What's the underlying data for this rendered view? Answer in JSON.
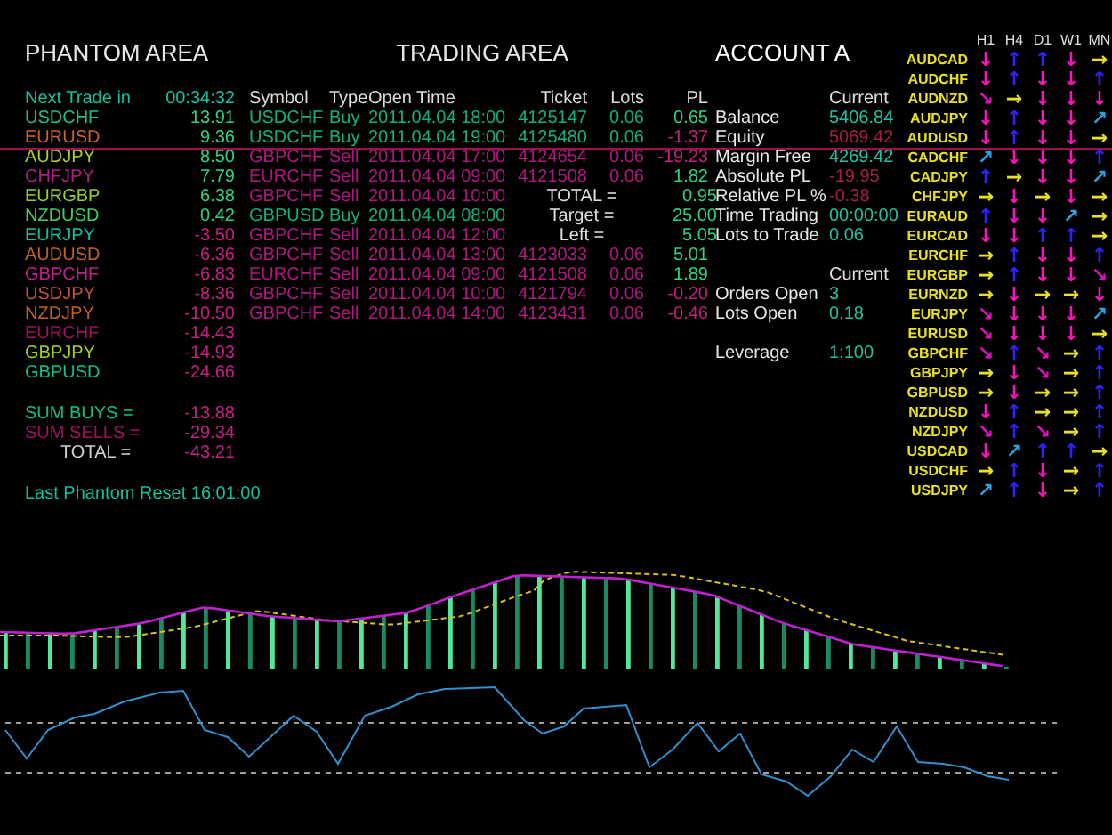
{
  "phantom": {
    "title": "PHANTOM AREA",
    "next_trade_label": "Next Trade in",
    "next_trade_time": "00:34:32",
    "pairs": [
      {
        "symbol": "USDCHF",
        "value": "13.91",
        "color": "#20c080",
        "negative": false
      },
      {
        "symbol": "EURUSD",
        "value": "9.36",
        "color": "#d06030",
        "negative": false
      },
      {
        "symbol": "AUDJPY",
        "value": "8.50",
        "color": "#a8d020",
        "negative": false
      },
      {
        "symbol": "CHFJPY",
        "value": "7.79",
        "color": "#b02080",
        "negative": false
      },
      {
        "symbol": "EURGBP",
        "value": "6.38",
        "color": "#90d030",
        "negative": false
      },
      {
        "symbol": "NZDUSD",
        "value": "0.42",
        "color": "#40d060",
        "negative": false
      },
      {
        "symbol": "EURJPY",
        "value": "-3.50",
        "color": "#10c0a0",
        "negative": true
      },
      {
        "symbol": "AUDUSD",
        "value": "-6.36",
        "color": "#c06030",
        "negative": true
      },
      {
        "symbol": "GBPCHF",
        "value": "-6.83",
        "color": "#c02090",
        "negative": true
      },
      {
        "symbol": "USDJPY",
        "value": "-8.36",
        "color": "#c05040",
        "negative": true
      },
      {
        "symbol": "NZDJPY",
        "value": "-10.50",
        "color": "#c06020",
        "negative": true
      },
      {
        "symbol": "EURCHF",
        "value": "-14.43",
        "color": "#a01060",
        "negative": true
      },
      {
        "symbol": "GBPJPY",
        "value": "-14.93",
        "color": "#a0d020",
        "negative": true
      },
      {
        "symbol": "GBPUSD",
        "value": "-24.66",
        "color": "#10c090",
        "negative": true
      }
    ],
    "sums": [
      {
        "label": "SUM BUYS =",
        "value": "-13.88",
        "color": "#10c080"
      },
      {
        "label": "SUM SELLS =",
        "value": "-29.34",
        "color": "#a01060"
      },
      {
        "label": "TOTAL =",
        "value": "-43.21",
        "color": "#d0d0d0"
      }
    ],
    "reset": "Last Phantom Reset 16:01:00"
  },
  "trading": {
    "title": "TRADING AREA",
    "columns": [
      "Symbol",
      "Type",
      "Open Time",
      "Ticket",
      "Lots",
      "PL"
    ],
    "trades": [
      {
        "kind": "trade",
        "symbol": "USDCHF",
        "type": "Buy",
        "open_time": "2011.04.04 18:00",
        "ticket": "4125147",
        "lots": "0.06",
        "pl": "0.65",
        "color": "#10b080",
        "pl_negative": false
      },
      {
        "kind": "trade",
        "symbol": "USDCHF",
        "type": "Buy",
        "open_time": "2011.04.04 19:00",
        "ticket": "4125480",
        "lots": "0.06",
        "pl": "-1.37",
        "color": "#10b080",
        "pl_negative": true
      },
      {
        "kind": "trade",
        "symbol": "GBPCHF",
        "type": "Sell",
        "open_time": "2011.04.04 17:00",
        "ticket": "4124654",
        "lots": "0.06",
        "pl": "-19.23",
        "color": "#b01880",
        "pl_negative": true
      },
      {
        "kind": "trade",
        "symbol": "EURCHF",
        "type": "Sell",
        "open_time": "2011.04.04 09:00",
        "ticket": "4121508",
        "lots": "0.06",
        "pl": "1.82",
        "color": "#b01880",
        "pl_negative": false
      },
      {
        "kind": "partial",
        "symbol": "GBPCHF",
        "type": "Sell",
        "open_time": "2011.04.04 10:00",
        "color": "#b01880"
      },
      {
        "kind": "partial",
        "symbol": "GBPUSD",
        "type": "Buy",
        "open_time": "2011.04.04 08:00",
        "color": "#10b080"
      },
      {
        "kind": "partial",
        "symbol": "GBPCHF",
        "type": "Sell",
        "open_time": "2011.04.04 12:00",
        "color": "#b01880"
      },
      {
        "kind": "trade",
        "symbol": "GBPCHF",
        "type": "Sell",
        "open_time": "2011.04.04 13:00",
        "ticket": "4123033",
        "lots": "0.06",
        "pl": "5.01",
        "color": "#b01880",
        "pl_negative": false
      },
      {
        "kind": "trade",
        "symbol": "EURCHF",
        "type": "Sell",
        "open_time": "2011.04.04 09:00",
        "ticket": "4121508",
        "lots": "0.06",
        "pl": "1.89",
        "color": "#b01880",
        "pl_negative": false
      },
      {
        "kind": "trade",
        "symbol": "GBPCHF",
        "type": "Sell",
        "open_time": "2011.04.04 10:00",
        "ticket": "4121794",
        "lots": "0.06",
        "pl": "-0.20",
        "color": "#b01880",
        "pl_negative": true
      },
      {
        "kind": "trade",
        "symbol": "GBPCHF",
        "type": "Sell",
        "open_time": "2011.04.04 14:00",
        "ticket": "4123431",
        "lots": "0.06",
        "pl": "-0.46",
        "color": "#b01880",
        "pl_negative": true
      }
    ],
    "summary": [
      {
        "label": "TOTAL =",
        "value": "0.95"
      },
      {
        "label": "Target =",
        "value": "25.00"
      },
      {
        "label": "Left =",
        "value": "5.05"
      }
    ]
  },
  "account": {
    "title": "ACCOUNT A",
    "sections": [
      {
        "header": "Current",
        "rows": [
          {
            "label": "Balance",
            "value": "5406.84",
            "color": "#20c0a0"
          },
          {
            "label": "Equity",
            "value": "5069.42",
            "color": "#a02040"
          },
          {
            "label": "Margin Free",
            "value": "4269.42",
            "color": "#20c0a0"
          },
          {
            "label": "Absolute PL",
            "value": "-19.95",
            "color": "#a02040"
          },
          {
            "label": "Relative PL %",
            "value": "-0.38",
            "color": "#a02040"
          },
          {
            "label": "Time Trading",
            "value": "00:00:00",
            "color": "#20c0a0"
          },
          {
            "label": "Lots to Trade",
            "value": "0.06",
            "color": "#20c0a0"
          }
        ]
      },
      {
        "header": "Current",
        "rows": [
          {
            "label": "Orders Open",
            "value": "3",
            "color": "#20c0a0"
          },
          {
            "label": "Lots Open",
            "value": "0.18",
            "color": "#20c0a0"
          }
        ]
      },
      {
        "rows": [
          {
            "label": "Leverage",
            "value": "1:100",
            "color": "#20c0a0"
          }
        ]
      }
    ]
  },
  "signals": {
    "timeframes": [
      "H1",
      "H4",
      "D1",
      "W1",
      "MN"
    ],
    "rows": [
      {
        "symbol": "AUDCAD",
        "trends": [
          {
            "arrow": "↓",
            "color": "#ff10c0"
          },
          {
            "arrow": "↑",
            "color": "#3020ff"
          },
          {
            "arrow": "↑",
            "color": "#3020ff"
          },
          {
            "arrow": "↓",
            "color": "#ff10c0"
          },
          {
            "arrow": "→",
            "color": "#e8e020"
          }
        ]
      },
      {
        "symbol": "AUDCHF",
        "trends": [
          {
            "arrow": "↓",
            "color": "#ff10c0"
          },
          {
            "arrow": "↑",
            "color": "#3020ff"
          },
          {
            "arrow": "↓",
            "color": "#ff10c0"
          },
          {
            "arrow": "↓",
            "color": "#ff10c0"
          },
          {
            "arrow": "↑",
            "color": "#3020ff"
          }
        ]
      },
      {
        "symbol": "AUDNZD",
        "trends": [
          {
            "arrow": "↘",
            "color": "#e010c0"
          },
          {
            "arrow": "→",
            "color": "#e8e020"
          },
          {
            "arrow": "↓",
            "color": "#ff10c0"
          },
          {
            "arrow": "↓",
            "color": "#ff10c0"
          },
          {
            "arrow": "↓",
            "color": "#ff10c0"
          }
        ]
      },
      {
        "symbol": "AUDJPY",
        "trends": [
          {
            "arrow": "↓",
            "color": "#ff10c0"
          },
          {
            "arrow": "↑",
            "color": "#3020ff"
          },
          {
            "arrow": "↓",
            "color": "#ff10c0"
          },
          {
            "arrow": "↓",
            "color": "#ff10c0"
          },
          {
            "arrow": "↗",
            "color": "#30a0e0"
          }
        ]
      },
      {
        "symbol": "AUDUSD",
        "trends": [
          {
            "arrow": "↓",
            "color": "#ff10c0"
          },
          {
            "arrow": "↑",
            "color": "#3020ff"
          },
          {
            "arrow": "↓",
            "color": "#ff10c0"
          },
          {
            "arrow": "↓",
            "color": "#ff10c0"
          },
          {
            "arrow": "→",
            "color": "#e8e020"
          }
        ]
      },
      {
        "symbol": "CADCHF",
        "trends": [
          {
            "arrow": "↗",
            "color": "#30a0e0"
          },
          {
            "arrow": "↓",
            "color": "#ff10c0"
          },
          {
            "arrow": "↓",
            "color": "#ff10c0"
          },
          {
            "arrow": "↓",
            "color": "#ff10c0"
          },
          {
            "arrow": "↑",
            "color": "#3020ff"
          }
        ]
      },
      {
        "symbol": "CADJPY",
        "trends": [
          {
            "arrow": "↑",
            "color": "#3020ff"
          },
          {
            "arrow": "→",
            "color": "#e8e020"
          },
          {
            "arrow": "↓",
            "color": "#ff10c0"
          },
          {
            "arrow": "↓",
            "color": "#ff10c0"
          },
          {
            "arrow": "↗",
            "color": "#30a0e0"
          }
        ]
      },
      {
        "symbol": "CHFJPY",
        "trends": [
          {
            "arrow": "→",
            "color": "#e8e020"
          },
          {
            "arrow": "↓",
            "color": "#ff10c0"
          },
          {
            "arrow": "→",
            "color": "#e8e020"
          },
          {
            "arrow": "↓",
            "color": "#ff10c0"
          },
          {
            "arrow": "→",
            "color": "#e8e020"
          }
        ]
      },
      {
        "symbol": "EURAUD",
        "trends": [
          {
            "arrow": "↑",
            "color": "#3020ff"
          },
          {
            "arrow": "↓",
            "color": "#ff10c0"
          },
          {
            "arrow": "↓",
            "color": "#ff10c0"
          },
          {
            "arrow": "↗",
            "color": "#30a0e0"
          },
          {
            "arrow": "→",
            "color": "#e8e020"
          }
        ]
      },
      {
        "symbol": "EURCAD",
        "trends": [
          {
            "arrow": "↓",
            "color": "#ff10c0"
          },
          {
            "arrow": "↓",
            "color": "#ff10c0"
          },
          {
            "arrow": "↑",
            "color": "#3020ff"
          },
          {
            "arrow": "↑",
            "color": "#3020ff"
          },
          {
            "arrow": "→",
            "color": "#e8e020"
          }
        ]
      },
      {
        "symbol": "EURCHF",
        "trends": [
          {
            "arrow": "→",
            "color": "#e8e020"
          },
          {
            "arrow": "↑",
            "color": "#3020ff"
          },
          {
            "arrow": "↓",
            "color": "#ff10c0"
          },
          {
            "arrow": "↓",
            "color": "#ff10c0"
          },
          {
            "arrow": "↑",
            "color": "#3020ff"
          }
        ]
      },
      {
        "symbol": "EURGBP",
        "trends": [
          {
            "arrow": "→",
            "color": "#e8e020"
          },
          {
            "arrow": "↑",
            "color": "#3020ff"
          },
          {
            "arrow": "↓",
            "color": "#ff10c0"
          },
          {
            "arrow": "↓",
            "color": "#ff10c0"
          },
          {
            "arrow": "↘",
            "color": "#e010c0"
          }
        ]
      },
      {
        "symbol": "EURNZD",
        "trends": [
          {
            "arrow": "→",
            "color": "#e8e020"
          },
          {
            "arrow": "↓",
            "color": "#ff10c0"
          },
          {
            "arrow": "→",
            "color": "#e8e020"
          },
          {
            "arrow": "→",
            "color": "#e8e020"
          },
          {
            "arrow": "↓",
            "color": "#ff10c0"
          }
        ]
      },
      {
        "symbol": "EURJPY",
        "trends": [
          {
            "arrow": "↘",
            "color": "#e010c0"
          },
          {
            "arrow": "↓",
            "color": "#ff10c0"
          },
          {
            "arrow": "↓",
            "color": "#ff10c0"
          },
          {
            "arrow": "↓",
            "color": "#ff10c0"
          },
          {
            "arrow": "↗",
            "color": "#30a0e0"
          }
        ]
      },
      {
        "symbol": "EURUSD",
        "trends": [
          {
            "arrow": "↘",
            "color": "#e010c0"
          },
          {
            "arrow": "↓",
            "color": "#ff10c0"
          },
          {
            "arrow": "↓",
            "color": "#ff10c0"
          },
          {
            "arrow": "↓",
            "color": "#ff10c0"
          },
          {
            "arrow": "→",
            "color": "#e8e020"
          }
        ]
      },
      {
        "symbol": "GBPCHF",
        "trends": [
          {
            "arrow": "↘",
            "color": "#e010c0"
          },
          {
            "arrow": "↑",
            "color": "#3020ff"
          },
          {
            "arrow": "↘",
            "color": "#e010c0"
          },
          {
            "arrow": "→",
            "color": "#e8e020"
          },
          {
            "arrow": "↑",
            "color": "#3020ff"
          }
        ]
      },
      {
        "symbol": "GBPJPY",
        "trends": [
          {
            "arrow": "→",
            "color": "#e8e020"
          },
          {
            "arrow": "↓",
            "color": "#ff10c0"
          },
          {
            "arrow": "↘",
            "color": "#e010c0"
          },
          {
            "arrow": "→",
            "color": "#e8e020"
          },
          {
            "arrow": "↑",
            "color": "#3020ff"
          }
        ]
      },
      {
        "symbol": "GBPUSD",
        "trends": [
          {
            "arrow": "→",
            "color": "#e8e020"
          },
          {
            "arrow": "↓",
            "color": "#ff10c0"
          },
          {
            "arrow": "→",
            "color": "#e8e020"
          },
          {
            "arrow": "→",
            "color": "#e8e020"
          },
          {
            "arrow": "↑",
            "color": "#3020ff"
          }
        ]
      },
      {
        "symbol": "NZDUSD",
        "trends": [
          {
            "arrow": "↓",
            "color": "#ff10c0"
          },
          {
            "arrow": "↑",
            "color": "#3020ff"
          },
          {
            "arrow": "→",
            "color": "#e8e020"
          },
          {
            "arrow": "→",
            "color": "#e8e020"
          },
          {
            "arrow": "↑",
            "color": "#3020ff"
          }
        ]
      },
      {
        "symbol": "NZDJPY",
        "trends": [
          {
            "arrow": "↘",
            "color": "#e010c0"
          },
          {
            "arrow": "↑",
            "color": "#3020ff"
          },
          {
            "arrow": "↘",
            "color": "#e010c0"
          },
          {
            "arrow": "→",
            "color": "#e8e020"
          },
          {
            "arrow": "↑",
            "color": "#3020ff"
          }
        ]
      },
      {
        "symbol": "USDCAD",
        "trends": [
          {
            "arrow": "↓",
            "color": "#ff10c0"
          },
          {
            "arrow": "↗",
            "color": "#30a0e0"
          },
          {
            "arrow": "↑",
            "color": "#3020ff"
          },
          {
            "arrow": "↑",
            "color": "#3020ff"
          },
          {
            "arrow": "→",
            "color": "#e8e020"
          }
        ]
      },
      {
        "symbol": "USDCHF",
        "trends": [
          {
            "arrow": "→",
            "color": "#e8e020"
          },
          {
            "arrow": "↑",
            "color": "#3020ff"
          },
          {
            "arrow": "↓",
            "color": "#ff10c0"
          },
          {
            "arrow": "→",
            "color": "#e8e020"
          },
          {
            "arrow": "↑",
            "color": "#3020ff"
          }
        ]
      },
      {
        "symbol": "USDJPY",
        "trends": [
          {
            "arrow": "↗",
            "color": "#30a0e0"
          },
          {
            "arrow": "↑",
            "color": "#3020ff"
          },
          {
            "arrow": "↓",
            "color": "#ff10c0"
          },
          {
            "arrow": "→",
            "color": "#e8e020"
          },
          {
            "arrow": "↑",
            "color": "#3020ff"
          }
        ]
      }
    ]
  }
}
